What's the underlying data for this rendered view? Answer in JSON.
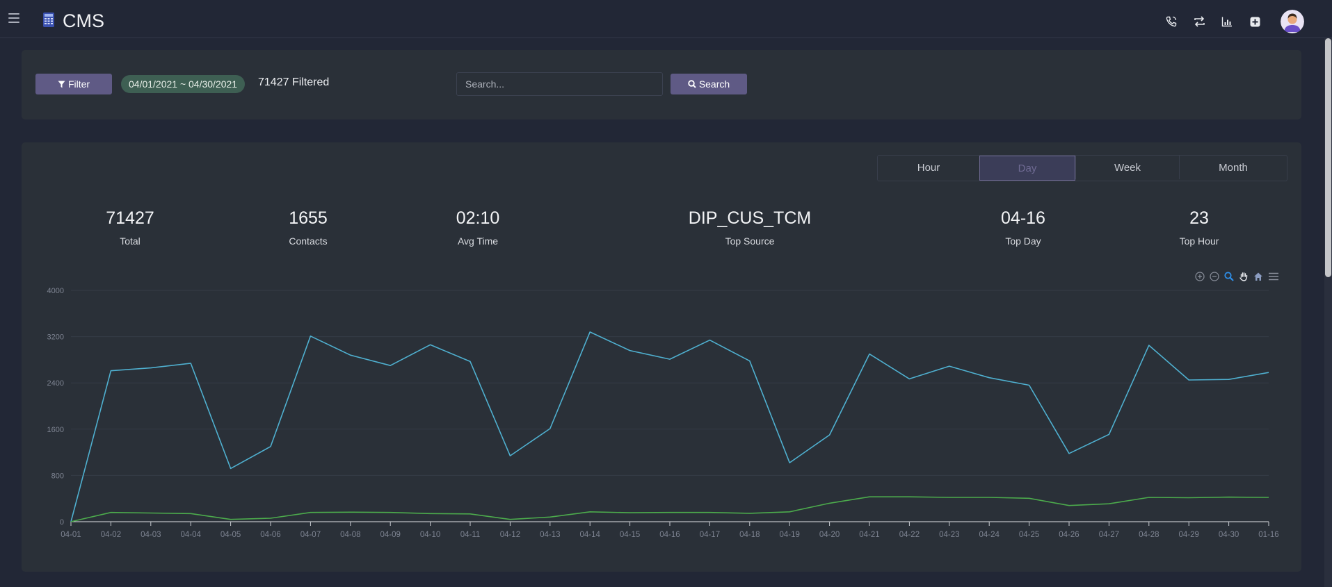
{
  "app": {
    "title": "CMS"
  },
  "topbar": {
    "icons": [
      "phone-call-icon",
      "swap-arrows-icon",
      "bar-chart-icon",
      "add-square-icon"
    ]
  },
  "filter_bar": {
    "filter_label": "Filter",
    "date_range": "04/01/2021 ~ 04/30/2021",
    "filtered_text": "71427 Filtered",
    "search_placeholder": "Search...",
    "search_label": "Search"
  },
  "period_tabs": [
    {
      "label": "Hour",
      "active": false
    },
    {
      "label": "Day",
      "active": true
    },
    {
      "label": "Week",
      "active": false
    },
    {
      "label": "Month",
      "active": false
    }
  ],
  "stats": [
    {
      "value": "71427",
      "label": "Total"
    },
    {
      "value": "1655",
      "label": "Contacts"
    },
    {
      "value": "02:10",
      "label": "Avg Time"
    },
    {
      "value": "DIP_CUS_TCM",
      "label": "Top Source"
    },
    {
      "value": "04-16",
      "label": "Top Day"
    },
    {
      "value": "23",
      "label": "Top Hour"
    }
  ],
  "chart_toolbar": [
    "zoom-in-icon",
    "zoom-out-icon",
    "selection-zoom-icon",
    "pan-hand-icon",
    "reset-home-icon",
    "menu-icon"
  ],
  "chart_data": {
    "type": "line",
    "x": [
      "04-01",
      "04-02",
      "04-03",
      "04-04",
      "04-05",
      "04-06",
      "04-07",
      "04-08",
      "04-09",
      "04-10",
      "04-11",
      "04-12",
      "04-13",
      "04-14",
      "04-15",
      "04-16",
      "04-17",
      "04-18",
      "04-19",
      "04-20",
      "04-21",
      "04-22",
      "04-23",
      "04-24",
      "04-25",
      "04-26",
      "04-27",
      "04-28",
      "04-29",
      "04-30",
      "01-16"
    ],
    "series": [
      {
        "color": "#4fb0d0",
        "values": [
          0,
          2610,
          2660,
          2740,
          920,
          1300,
          3210,
          2880,
          2700,
          3060,
          2770,
          1140,
          1610,
          3280,
          2960,
          2810,
          3140,
          2780,
          1020,
          1500,
          2900,
          2470,
          2690,
          2490,
          2360,
          1180,
          1510,
          3050,
          2450,
          2460,
          2580
        ]
      },
      {
        "color": "#4cab4c",
        "values": [
          0,
          160,
          150,
          140,
          40,
          60,
          160,
          165,
          160,
          140,
          135,
          40,
          80,
          170,
          155,
          160,
          160,
          145,
          170,
          320,
          430,
          430,
          420,
          420,
          405,
          280,
          310,
          420,
          415,
          425,
          420
        ]
      }
    ],
    "ylim": [
      0,
      4000
    ],
    "yticks": [
      "0",
      "800",
      "1600",
      "2400",
      "3200",
      "4000"
    ],
    "grid": true,
    "legend": "none"
  }
}
